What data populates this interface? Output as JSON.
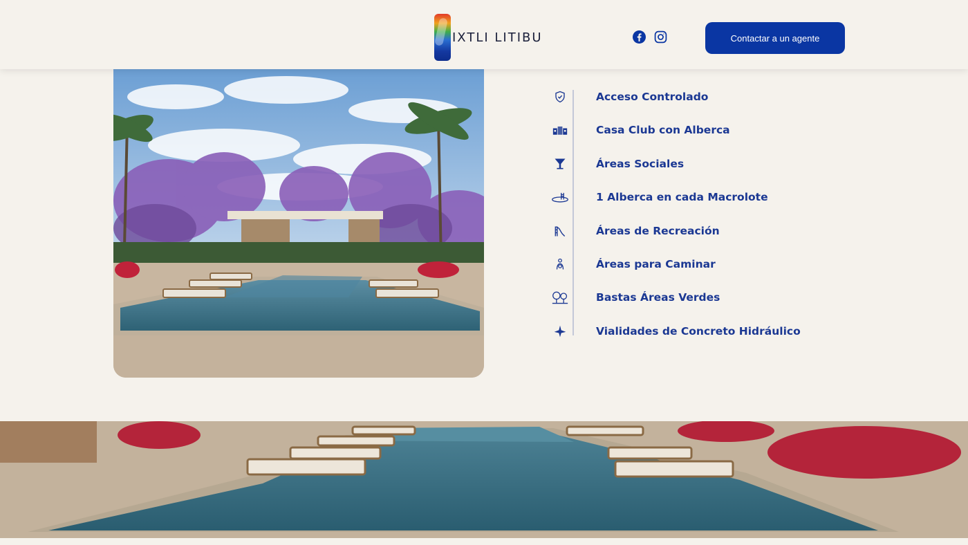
{
  "header": {
    "logo_text": "IXTLI LITIBU",
    "cta_label": "Contactar a un agente",
    "social_icons": [
      "facebook-icon",
      "instagram-icon"
    ]
  },
  "amenities": [
    {
      "label": "Acceso Controlado",
      "icon": "shield-check-icon"
    },
    {
      "label": "Casa Club con Alberca",
      "icon": "clubhouse-icon"
    },
    {
      "label": "Áreas Sociales",
      "icon": "cocktail-icon"
    },
    {
      "label": "1 Alberca en cada Macrolote",
      "icon": "pool-ladder-icon"
    },
    {
      "label": "Áreas de Recreación",
      "icon": "slide-icon"
    },
    {
      "label": "Áreas para Caminar",
      "icon": "walking-person-icon"
    },
    {
      "label": "Bastas Áreas Verdes",
      "icon": "trees-icon"
    },
    {
      "label": "Vialidades de Concreto Hidráulico",
      "icon": "road-icon"
    }
  ],
  "colors": {
    "background": "#f5f2ec",
    "accent": "#0a36a3",
    "text": "#1b3893"
  }
}
